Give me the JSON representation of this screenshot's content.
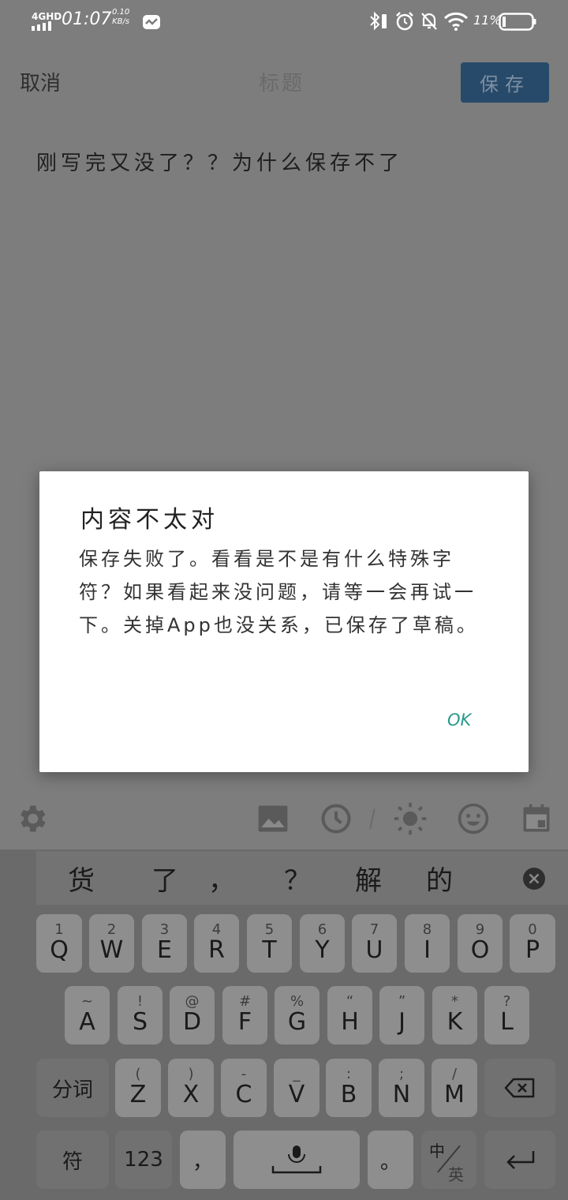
{
  "status_bar": {
    "network": "4GHD",
    "time": "01:07",
    "speed_value": "0.10",
    "speed_unit": "KB/s",
    "battery_percent": "11%"
  },
  "header": {
    "cancel_label": "取消",
    "title_placeholder": "标题",
    "save_label": "保存"
  },
  "note": {
    "content": "刚写完又没了？？为什么保存不了"
  },
  "dialog": {
    "title": "内容不太对",
    "message": "保存失败了。看看是不是有什么特殊字符？如果看起来没问题，请等一会再试一下。关掉App也没关系，已保存了草稿。",
    "ok_label": "OK"
  },
  "toolbar": {
    "icons": [
      "settings-icon",
      "image-icon",
      "clock-icon",
      "brightness-icon",
      "emoji-icon",
      "calendar-icon"
    ]
  },
  "keyboard": {
    "candidates": [
      "货",
      "了",
      "，",
      "？",
      "解",
      "的"
    ],
    "row1": [
      {
        "sub": "1",
        "key": "Q"
      },
      {
        "sub": "2",
        "key": "W"
      },
      {
        "sub": "3",
        "key": "E"
      },
      {
        "sub": "4",
        "key": "R"
      },
      {
        "sub": "5",
        "key": "T"
      },
      {
        "sub": "6",
        "key": "Y"
      },
      {
        "sub": "7",
        "key": "U"
      },
      {
        "sub": "8",
        "key": "I"
      },
      {
        "sub": "9",
        "key": "O"
      },
      {
        "sub": "0",
        "key": "P"
      }
    ],
    "row2": [
      {
        "sub": "~",
        "key": "A"
      },
      {
        "sub": "!",
        "key": "S"
      },
      {
        "sub": "@",
        "key": "D"
      },
      {
        "sub": "#",
        "key": "F"
      },
      {
        "sub": "%",
        "key": "G"
      },
      {
        "sub": "“",
        "key": "H"
      },
      {
        "sub": "”",
        "key": "J"
      },
      {
        "sub": "*",
        "key": "K"
      },
      {
        "sub": "?",
        "key": "L"
      }
    ],
    "row3": [
      {
        "sub": "(",
        "key": "Z"
      },
      {
        "sub": ")",
        "key": "X"
      },
      {
        "sub": "-",
        "key": "C"
      },
      {
        "sub": "_",
        "key": "V"
      },
      {
        "sub": ":",
        "key": "B"
      },
      {
        "sub": ";",
        "key": "N"
      },
      {
        "sub": "/",
        "key": "M"
      }
    ],
    "segment_label": "分词",
    "symbol_label": "符",
    "numeric_label": "123",
    "comma_label": "，",
    "period_label": "。",
    "lang_zh": "中",
    "lang_en": "英"
  }
}
